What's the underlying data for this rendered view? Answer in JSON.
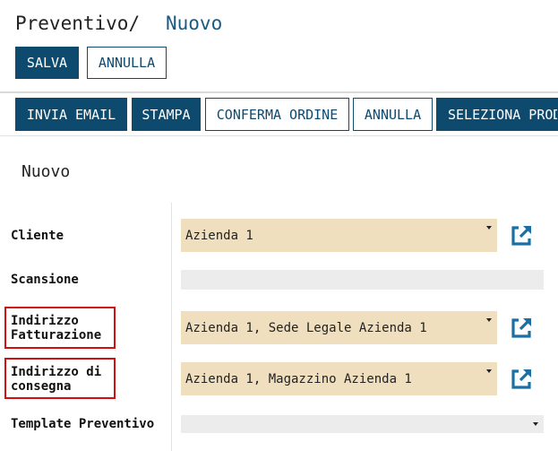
{
  "header": {
    "title": "Preventivo",
    "separator": "/",
    "crumb": "Nuovo"
  },
  "form_actions": {
    "save_label": "SALVA",
    "cancel_label": "ANNULLA"
  },
  "toolbar": {
    "send_email_label": "INVIA EMAIL",
    "print_label": "STAMPA",
    "confirm_order_label": "CONFERMA ORDINE",
    "cancel_label": "ANNULLA",
    "select_products_label": "SELEZIONA PRODOTTI"
  },
  "section": {
    "title": "Nuovo"
  },
  "fields": {
    "cliente": {
      "label": "Cliente",
      "value": "Azienda 1"
    },
    "scansione": {
      "label": "Scansione",
      "value": ""
    },
    "indirizzo_fatturazione": {
      "label": "Indirizzo\nFatturazione",
      "value": "Azienda 1, Sede Legale Azienda 1"
    },
    "indirizzo_consegna": {
      "label": "Indirizzo di\nconsegna",
      "value": "Azienda 1, Magazzino Azienda 1"
    },
    "template_preventivo": {
      "label": "Template Preventivo",
      "value": ""
    }
  },
  "icons": {
    "open_external": "external-link-icon"
  },
  "colors": {
    "primary": "#0e4a6e",
    "select_bg": "#efdfbf",
    "highlight_border": "#d01010",
    "icon": "#1b6fa3"
  }
}
